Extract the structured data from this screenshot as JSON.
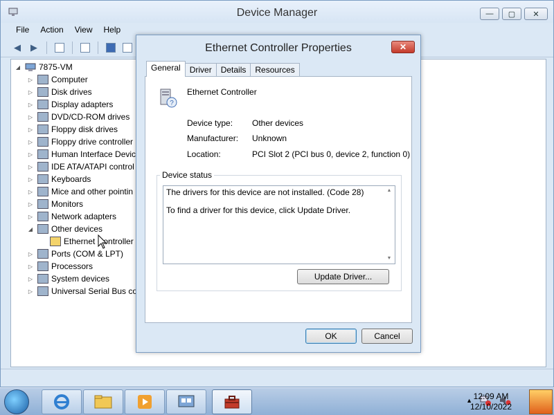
{
  "window": {
    "title": "Device Manager",
    "controls": {
      "minimize": "—",
      "maximize": "▢",
      "close": "✕"
    }
  },
  "menu": [
    "File",
    "Action",
    "View",
    "Help"
  ],
  "tree": {
    "root": "7875-VM",
    "items": [
      {
        "label": "Computer",
        "expander": "▷",
        "icon": "computer-icon"
      },
      {
        "label": "Disk drives",
        "expander": "▷",
        "icon": "disk-drive-icon"
      },
      {
        "label": "Display adapters",
        "expander": "▷",
        "icon": "display-adapter-icon"
      },
      {
        "label": "DVD/CD-ROM drives",
        "expander": "▷",
        "icon": "dvd-drive-icon"
      },
      {
        "label": "Floppy disk drives",
        "expander": "▷",
        "icon": "floppy-disk-icon"
      },
      {
        "label": "Floppy drive controller",
        "expander": "▷",
        "icon": "floppy-controller-icon"
      },
      {
        "label": "Human Interface Devic",
        "expander": "▷",
        "icon": "hid-icon"
      },
      {
        "label": "IDE ATA/ATAPI control",
        "expander": "▷",
        "icon": "ide-controller-icon"
      },
      {
        "label": "Keyboards",
        "expander": "▷",
        "icon": "keyboard-icon"
      },
      {
        "label": "Mice and other pointin",
        "expander": "▷",
        "icon": "mouse-icon"
      },
      {
        "label": "Monitors",
        "expander": "▷",
        "icon": "monitor-icon"
      },
      {
        "label": "Network adapters",
        "expander": "▷",
        "icon": "network-adapter-icon"
      },
      {
        "label": "Other devices",
        "expander": "◢",
        "icon": "unknown-device-icon"
      },
      {
        "label": "Ethernet Controller",
        "expander": "",
        "icon": "warning-device-icon",
        "child": true
      },
      {
        "label": "Ports (COM & LPT)",
        "expander": "▷",
        "icon": "port-icon"
      },
      {
        "label": "Processors",
        "expander": "▷",
        "icon": "processor-icon"
      },
      {
        "label": "System devices",
        "expander": "▷",
        "icon": "system-device-icon"
      },
      {
        "label": "Universal Serial Bus co",
        "expander": "▷",
        "icon": "usb-icon"
      }
    ]
  },
  "dialog": {
    "title": "Ethernet Controller Properties",
    "close": "✕",
    "tabs": [
      "General",
      "Driver",
      "Details",
      "Resources"
    ],
    "active_tab": "General",
    "device_name": "Ethernet Controller",
    "fields": [
      {
        "label": "Device type:",
        "value": "Other devices"
      },
      {
        "label": "Manufacturer:",
        "value": "Unknown"
      },
      {
        "label": "Location:",
        "value": "PCI Slot 2 (PCI bus 0, device 2, function 0)"
      }
    ],
    "status_group_title": "Device status",
    "status_lines": [
      "The drivers for this device are not installed. (Code 28)",
      "To find a driver for this device, click Update Driver."
    ],
    "update_driver_button": "Update Driver...",
    "ok_button": "OK",
    "cancel_button": "Cancel"
  },
  "taskbar": {
    "clock_time": "12:09 AM",
    "clock_date": "12/10/2022",
    "tray_arrow": "▲"
  }
}
